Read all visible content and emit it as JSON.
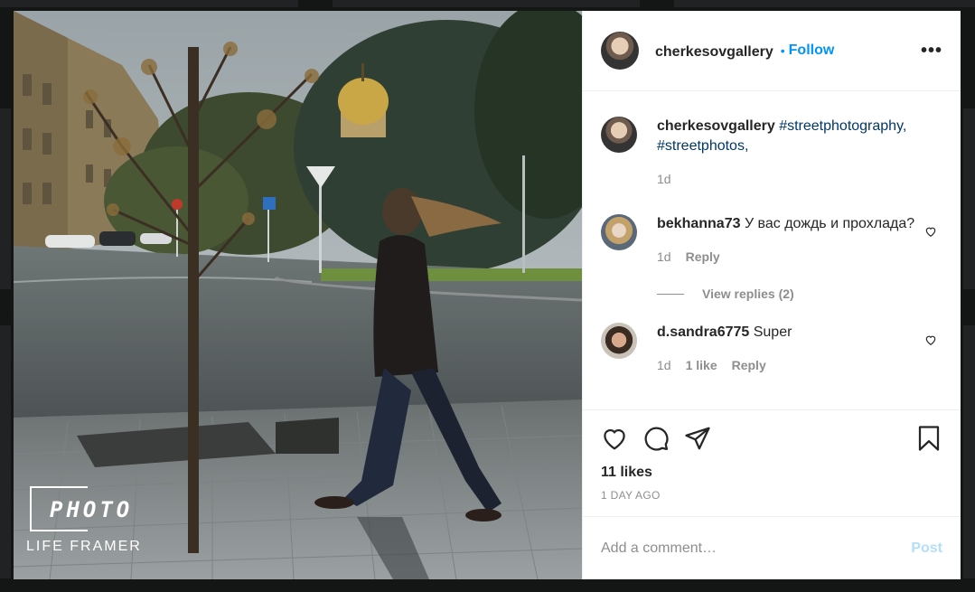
{
  "post": {
    "author": "cherkesovgallery",
    "follow_label": "Follow",
    "separator": "•",
    "more_label": "•••",
    "caption": {
      "user": "cherkesovgallery",
      "hashtag1": "#streetphotography,",
      "hashtag2": "#streetphotos,",
      "time": "1d"
    },
    "comments": [
      {
        "user": "bekhanna73",
        "text": "У вас дождь и прохлада?",
        "time": "1d",
        "reply": "Reply",
        "view_replies": "View replies (2)"
      },
      {
        "user": "d.sandra6775",
        "text": "Super",
        "time": "1d",
        "likes": "1 like",
        "reply": "Reply"
      }
    ],
    "likes": "11 likes",
    "date": "1 DAY AGO",
    "comment_placeholder": "Add a comment…",
    "post_label": "Post"
  },
  "watermark": {
    "word": "PHOTO",
    "sub": "LIFE FRAMER"
  },
  "colors": {
    "link": "#0095f6",
    "hashtag": "#00376b",
    "muted": "#8e8e8e",
    "post_disabled": "#b2dffc"
  }
}
